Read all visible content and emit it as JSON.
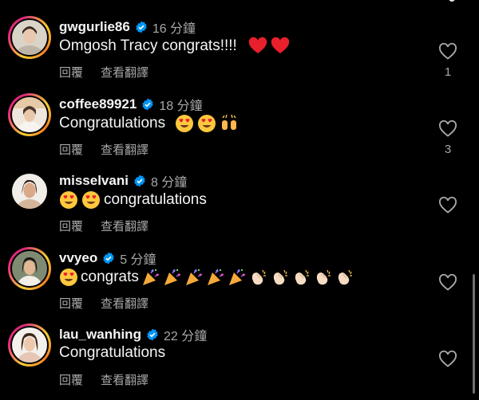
{
  "comments": [
    {
      "username": "gwgurlie86",
      "time": "16 分鐘",
      "text": "Omgosh Tracy congrats!!!!",
      "emojis": [
        "red-heart",
        "red-heart"
      ],
      "likes": "1",
      "story_ring": true
    },
    {
      "username": "coffee89921",
      "time": "18 分鐘",
      "text": "Congratulations",
      "emojis": [
        "heart-eyes",
        "heart-eyes",
        "raised-hands"
      ],
      "likes": "3",
      "story_ring": true
    },
    {
      "username": "misselvani",
      "time": "8 分鐘",
      "text": "congratulations",
      "emoji_prefix": [
        "heart-eyes",
        "heart-eyes"
      ],
      "likes": "",
      "story_ring": false
    },
    {
      "username": "vvyeo",
      "time": "5 分鐘",
      "text": "congrats",
      "emoji_prefix": [
        "heart-eyes"
      ],
      "emojis": [
        "party-popper",
        "party-popper",
        "party-popper",
        "party-popper",
        "party-popper",
        "clapping-hands",
        "clapping-hands",
        "clapping-hands",
        "clapping-hands",
        "clapping-hands"
      ],
      "likes": "",
      "story_ring": true
    },
    {
      "username": "lau_wanhing",
      "time": "22 分鐘",
      "text": "Congratulations",
      "likes": "",
      "story_ring": true
    }
  ],
  "actions": {
    "reply": "回覆",
    "translate": "查看翻譯"
  },
  "colors": {
    "background": "#000000",
    "verified": "#0095f6",
    "secondary_text": "#a8a8a8"
  }
}
